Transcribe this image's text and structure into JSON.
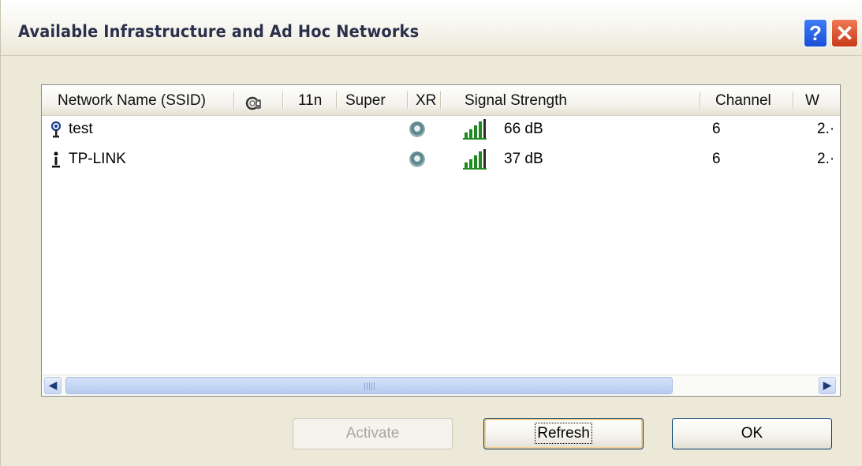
{
  "window": {
    "title": "Available Infrastructure and Ad Hoc Networks",
    "help_glyph": "?",
    "close_glyph": "✕"
  },
  "table": {
    "columns": [
      {
        "id": "ssid",
        "label": "Network Name (SSID)"
      },
      {
        "id": "security",
        "label": "",
        "icon": "lock-key-icon"
      },
      {
        "id": "11n",
        "label": "11n"
      },
      {
        "id": "super",
        "label": "Super"
      },
      {
        "id": "xr",
        "label": "XR"
      },
      {
        "id": "signal",
        "label": "Signal Strength"
      },
      {
        "id": "channel",
        "label": "Channel"
      },
      {
        "id": "wireless_mode",
        "label": "W"
      }
    ],
    "rows": [
      {
        "ssid": "test",
        "ssid_icon": "access-point-antenna-icon",
        "xr_icon": "xr-badge-icon",
        "signal_icon": "signal-bars-icon",
        "signal": "66 dB",
        "channel": "6",
        "wireless_mode": "2.·"
      },
      {
        "ssid": "TP-LINK",
        "ssid_icon": "adhoc-station-icon",
        "xr_icon": "xr-badge-icon",
        "signal_icon": "signal-bars-icon",
        "signal": "37 dB",
        "channel": "6",
        "wireless_mode": "2.·"
      }
    ]
  },
  "scrollbar": {
    "left_arrow": "◀",
    "right_arrow": "▶"
  },
  "buttons": {
    "activate": "Activate",
    "refresh": "Refresh",
    "ok": "OK"
  },
  "colors": {
    "titlebar_text": "#2a2f4a",
    "signal_green": "#1f8a1f",
    "help_blue": "#1a4fd6",
    "close_red": "#c83a15"
  }
}
